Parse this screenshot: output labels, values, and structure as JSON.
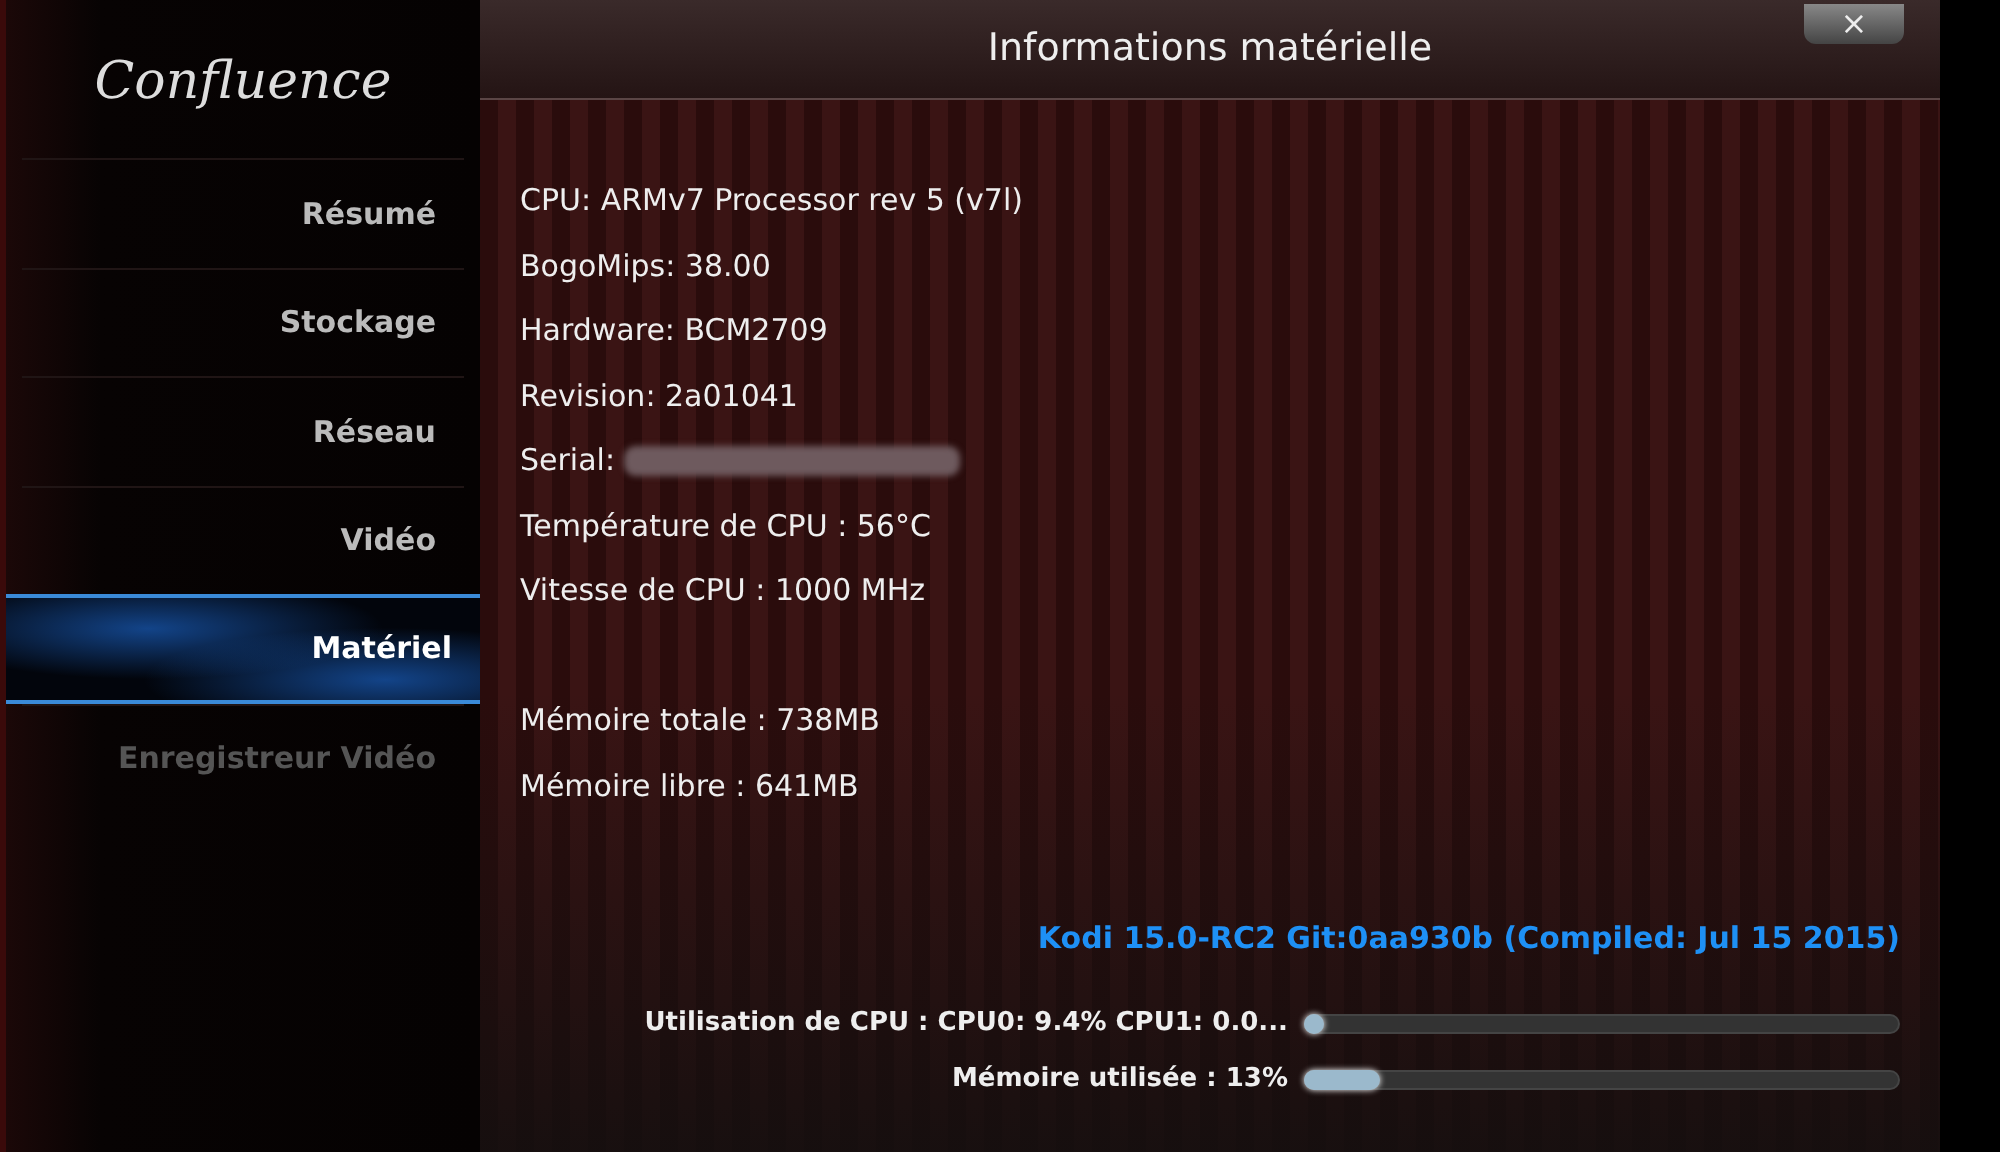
{
  "logo": "Confluence",
  "sidebar": {
    "items": [
      {
        "label": "Résumé",
        "selected": false,
        "disabled": false
      },
      {
        "label": "Stockage",
        "selected": false,
        "disabled": false
      },
      {
        "label": "Réseau",
        "selected": false,
        "disabled": false
      },
      {
        "label": "Vidéo",
        "selected": false,
        "disabled": false
      },
      {
        "label": "Matériel",
        "selected": true,
        "disabled": false
      },
      {
        "label": "Enregistreur Vidéo",
        "selected": false,
        "disabled": true
      }
    ]
  },
  "dialog": {
    "title": "Informations matérielle",
    "close": "×"
  },
  "info_lines": [
    {
      "text": "CPU: ARMv7 Processor rev 5 (v7l)",
      "redacted": false
    },
    {
      "text": "BogoMips: 38.00",
      "redacted": false
    },
    {
      "text": "Hardware: BCM2709",
      "redacted": false
    },
    {
      "text": "Revision: 2a01041",
      "redacted": false
    },
    {
      "text": "Serial:",
      "redacted": true
    },
    {
      "text": "Température de CPU : 56°C",
      "redacted": false
    },
    {
      "text": "Vitesse de CPU : 1000 MHz",
      "redacted": false
    }
  ],
  "memory_lines": [
    {
      "text": "Mémoire totale : 738MB",
      "redacted": false
    },
    {
      "text": "Mémoire libre : 641MB",
      "redacted": false
    }
  ],
  "version": "Kodi 15.0-RC2 Git:0aa930b (Compiled: Jul 15 2015)",
  "meters": [
    {
      "label": "Utilisation de CPU : CPU0: 9.4% CPU1: 0.0...",
      "level": 0.0
    },
    {
      "label": "Mémoire utilisée : 13%",
      "level": 0.13
    }
  ]
}
